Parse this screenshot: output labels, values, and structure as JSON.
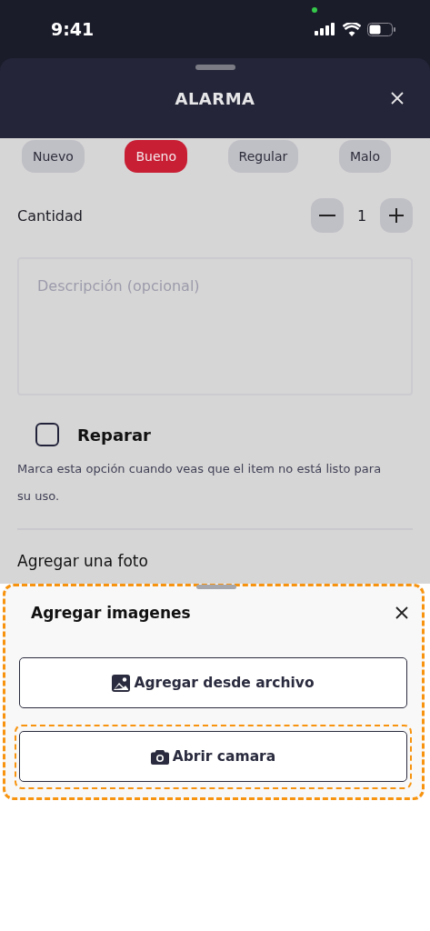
{
  "status_bar": {
    "time": "9:41"
  },
  "sheet": {
    "title": "ALARMA"
  },
  "conditions": [
    {
      "label": "Nuevo",
      "selected": false
    },
    {
      "label": "Bueno",
      "selected": true
    },
    {
      "label": "Regular",
      "selected": false
    },
    {
      "label": "Malo",
      "selected": false
    }
  ],
  "quantity": {
    "label": "Cantidad",
    "value": "1"
  },
  "description": {
    "placeholder": "Descripción (opcional)"
  },
  "repair": {
    "label": "Reparar",
    "checked": false,
    "hint": "Marca esta opción cuando veas que el item no está listo para su uso."
  },
  "photo_section": {
    "title": "Agregar una foto"
  },
  "image_sheet": {
    "title": "Agregar imagenes",
    "highlighted": true,
    "buttons": [
      {
        "kind": "file",
        "label": "Agregar desde archivo",
        "highlighted": false
      },
      {
        "kind": "camera",
        "label": "Abrir camara",
        "highlighted": true
      }
    ]
  }
}
